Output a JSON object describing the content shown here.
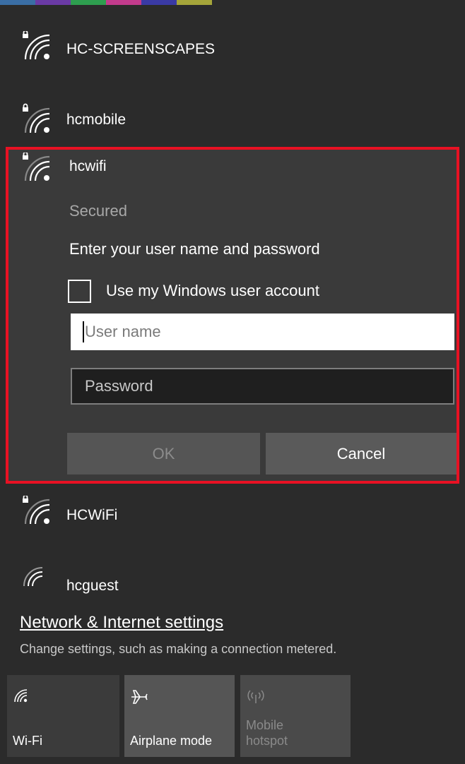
{
  "networks": [
    {
      "name": "HC-SCREENSCAPES",
      "secured": true
    },
    {
      "name": "hcmobile",
      "secured": true
    },
    {
      "name": "HCWiFi",
      "secured": true
    },
    {
      "name": "hcguest",
      "secured": false
    }
  ],
  "selected": {
    "name": "hcwifi",
    "status": "Secured",
    "prompt": "Enter your user name and password",
    "checkbox_label": "Use my Windows user account",
    "checkbox_checked": false,
    "username_placeholder": "User name",
    "password_placeholder": "Password",
    "ok_label": "OK",
    "cancel_label": "Cancel"
  },
  "settings": {
    "link": "Network & Internet settings",
    "description": "Change settings, such as making a connection metered."
  },
  "tiles": {
    "wifi": "Wi-Fi",
    "airplane": "Airplane mode",
    "hotspot_line1": "Mobile",
    "hotspot_line2": "hotspot"
  },
  "colors": {
    "background": "#2b2b2b",
    "selection_border": "#e81123",
    "selected_bg": "#3a3a3a"
  },
  "icons": [
    "wifi-secured-icon",
    "lock-icon",
    "wifi-icon",
    "airplane-icon",
    "mobile-hotspot-icon"
  ]
}
